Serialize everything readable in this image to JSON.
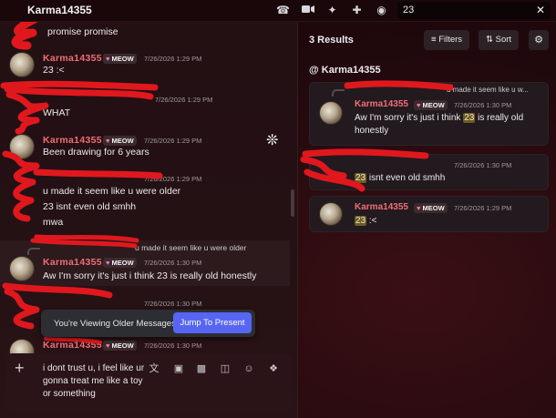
{
  "header": {
    "channel_name": "Karma14355",
    "search_value": "23",
    "icons": [
      "phone-icon",
      "video-icon",
      "pin-icon",
      "add-friend-icon",
      "profile-icon",
      "close-icon"
    ]
  },
  "chat": {
    "messages": [
      {
        "id": "m0",
        "text": "promise promise"
      },
      {
        "id": "m1",
        "username": "Karma14355",
        "badge": "MEOW",
        "time": "7/26/2026 1:29 PM",
        "lines": [
          "23 :<"
        ]
      },
      {
        "id": "m2",
        "time": "7/26/2026 1:29 PM",
        "lines": [
          "WHAT"
        ]
      },
      {
        "id": "m3",
        "username": "Karma14355",
        "badge": "MEOW",
        "time": "7/26/2026 1:29 PM",
        "lines": [
          "Been drawing for 6 years"
        ]
      },
      {
        "id": "m4",
        "time": "7/26/2026 1:29 PM",
        "lines": [
          "u made it seem like u were older",
          "23 isnt even old smhh",
          "mwa"
        ]
      },
      {
        "id": "m5",
        "reply": "u made it seem like u were older",
        "username": "Karma14355",
        "badge": "MEOW",
        "time": "7/26/2026 1:30 PM",
        "lines": [
          "Aw I'm sorry it's just i think 23 is really old honestly"
        ]
      },
      {
        "id": "m6",
        "time": "7/26/2026 1:30 PM"
      },
      {
        "id": "m7",
        "username": "Karma14355",
        "badge": "MEOW",
        "time": "7/26/2026 1:30 PM"
      }
    ],
    "older_bar": {
      "label": "You're Viewing Older Messages",
      "jump_label": "Jump To Present"
    },
    "composer": {
      "value": "i dont trust u, i feel like ur gonna treat me like a toy or something",
      "icons": [
        "translate-icon",
        "gift-icon",
        "gif-icon",
        "sticker-icon",
        "emoji-icon",
        "apps-icon"
      ]
    }
  },
  "results": {
    "count_label": "3 Results",
    "filters_label": "Filters",
    "sort_label": "Sort",
    "channel_label": "@ Karma14355",
    "cards": [
      {
        "reply": "u made it seem like u w...",
        "username": "Karma14355",
        "badge": "MEOW",
        "time": "7/26/2026 1:30 PM",
        "text_before": "Aw I'm sorry it's just i think ",
        "match": "23",
        "text_after": " is really old honestly"
      },
      {
        "time": "7/26/2026 1:30 PM",
        "text_before": "",
        "match": "23",
        "text_after": " isnt even old smhh"
      },
      {
        "username": "Karma14355",
        "badge": "MEOW",
        "time": "7/26/2026 1:29 PM",
        "text_before": "",
        "match": "23",
        "text_after": " :<"
      }
    ]
  },
  "colors": {
    "accent": "#5865f2",
    "username": "#f06e75",
    "badge_heart": "#f27aa7",
    "highlight": "#6b5a2a",
    "scribble": "#e0181e"
  }
}
